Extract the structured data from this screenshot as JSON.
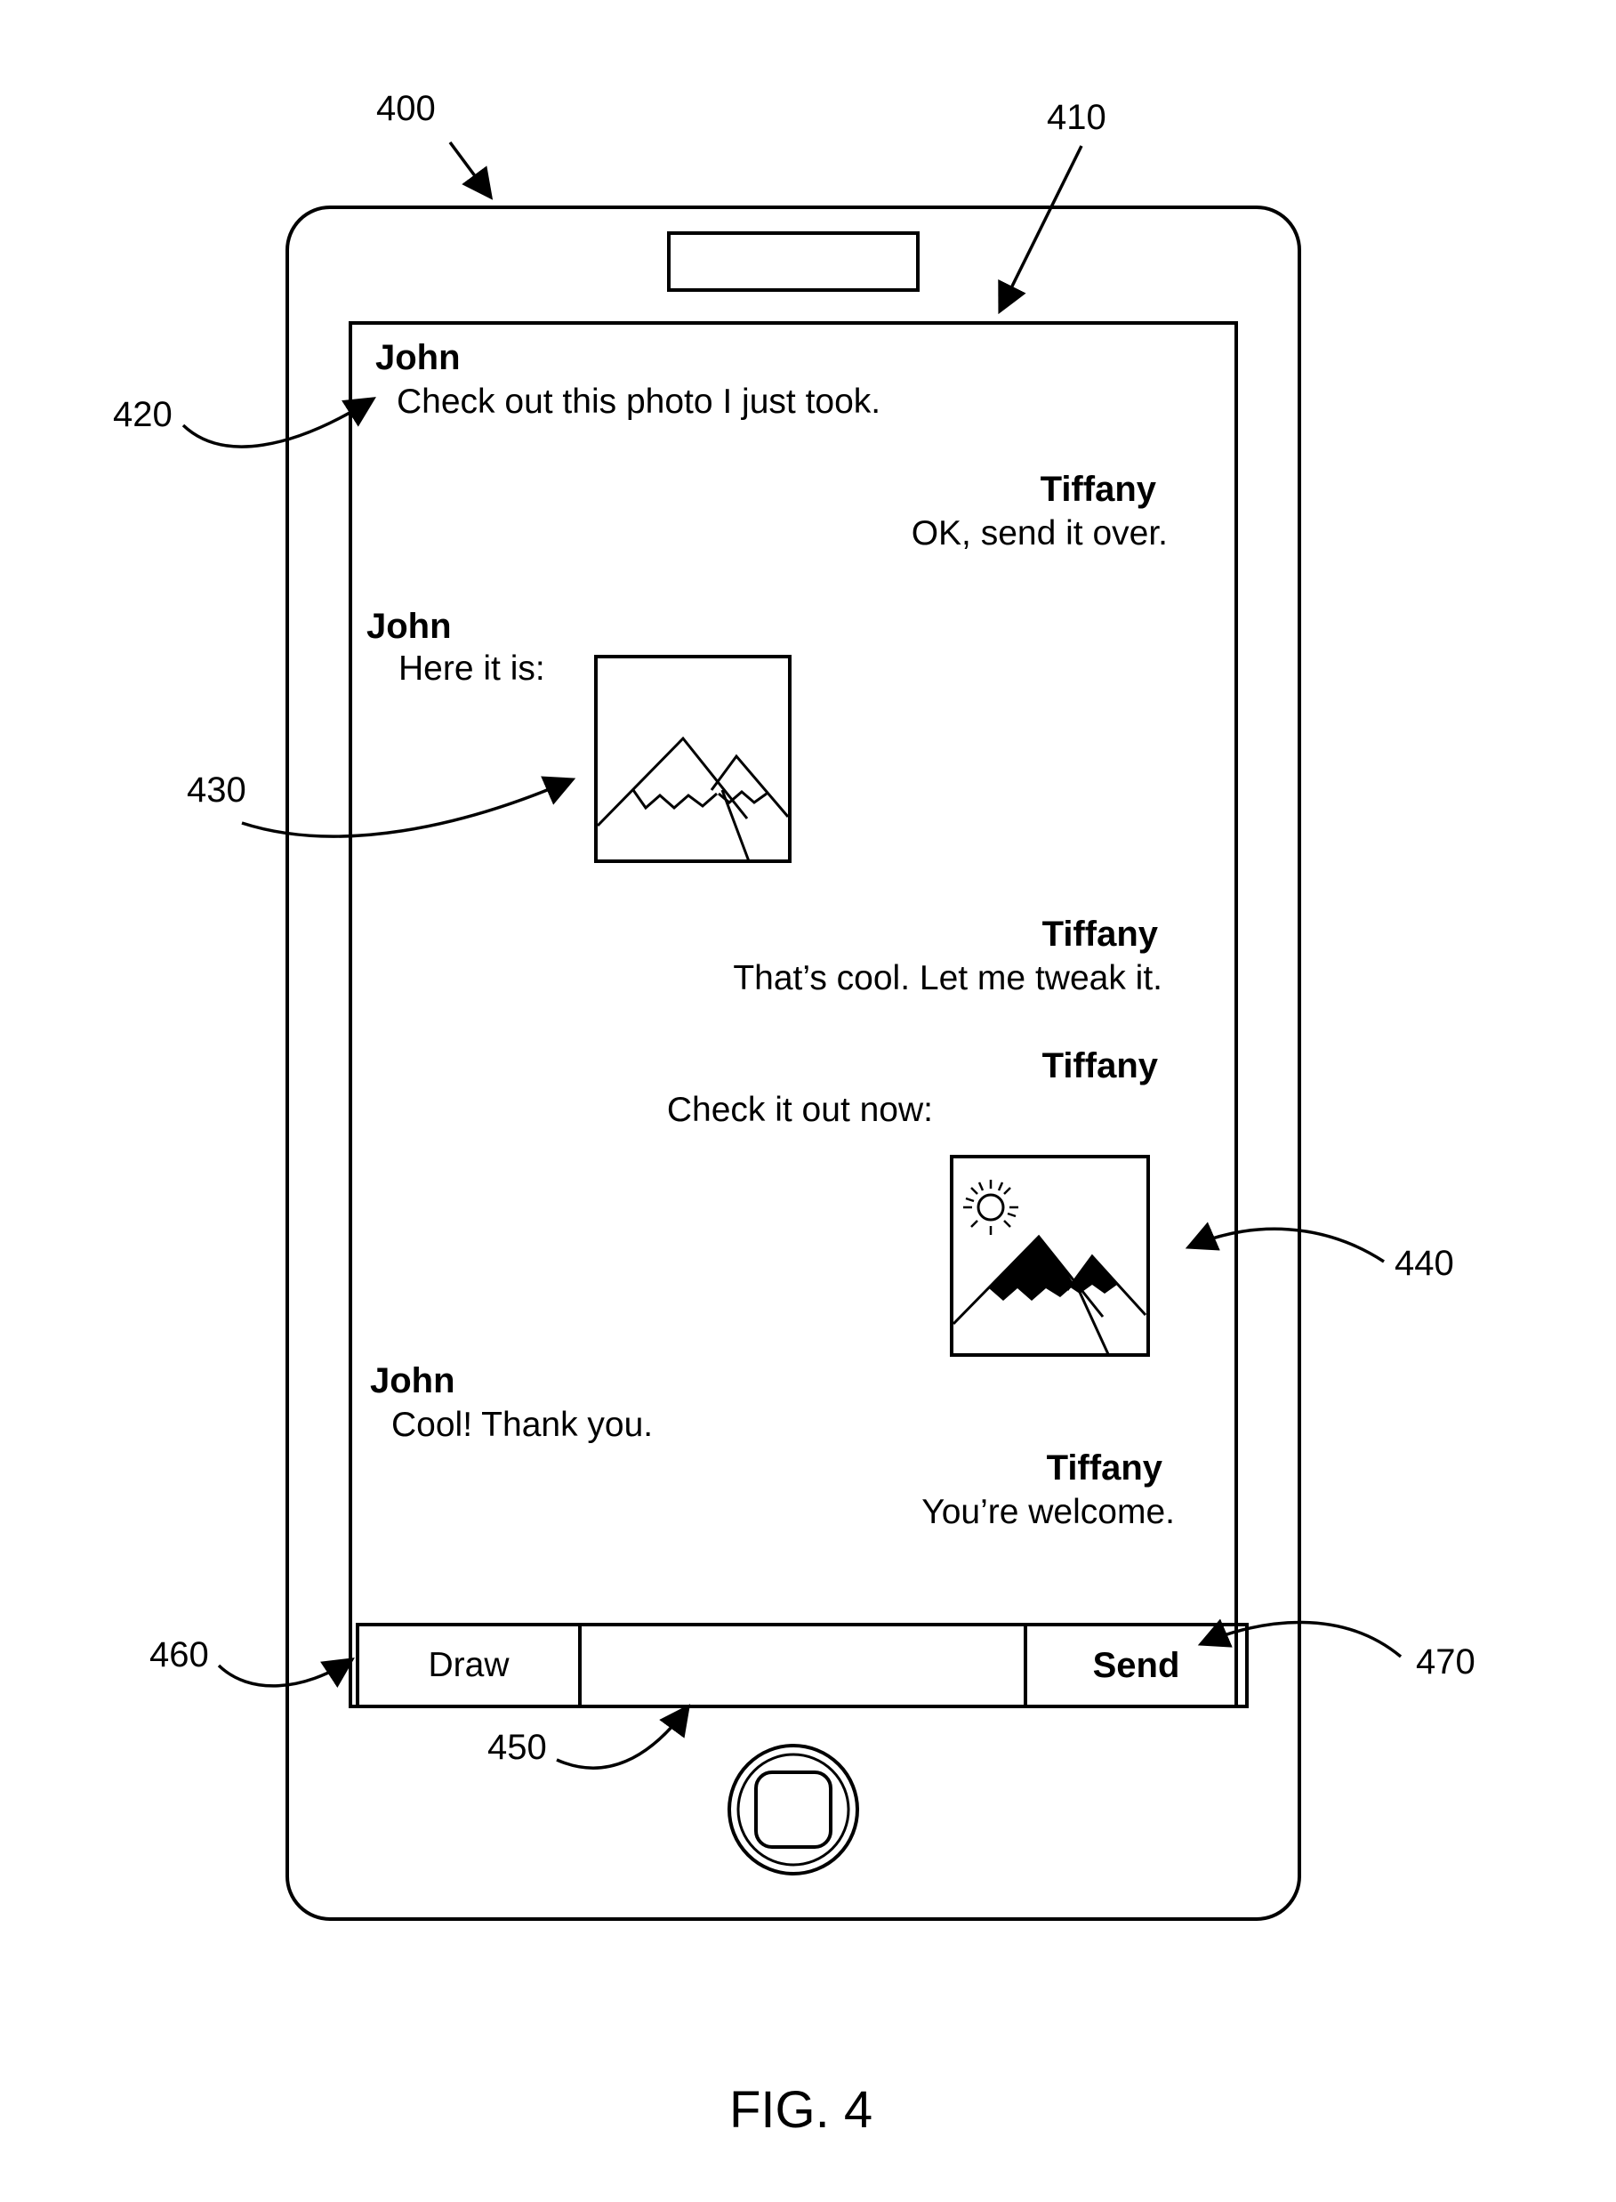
{
  "figure": {
    "caption": "FIG. 4"
  },
  "refs": {
    "device": "400",
    "screen": "410",
    "message": "420",
    "received_image": "430",
    "edited_image": "440",
    "text_input": "450",
    "draw_button": "460",
    "send_button": "470"
  },
  "messages": [
    {
      "sender": "John",
      "text": "Check out this photo I just took."
    },
    {
      "sender": "Tiffany",
      "text": "OK, send it over."
    },
    {
      "sender": "John",
      "text": "Here it is:"
    },
    {
      "sender": "Tiffany",
      "text": "That’s cool. Let me tweak it."
    },
    {
      "sender": "Tiffany",
      "text": "Check it out now:"
    },
    {
      "sender": "John",
      "text": "Cool! Thank you."
    },
    {
      "sender": "Tiffany",
      "text": "You’re welcome."
    }
  ],
  "images": [
    {
      "icon": "mountain-photo-icon"
    },
    {
      "icon": "mountain-photo-with-sun-icon"
    }
  ],
  "input_bar": {
    "draw_label": "Draw",
    "input_value": "",
    "send_label": "Send"
  },
  "device": {
    "home_button_icon": "home-button-icon",
    "speaker_icon": "speaker-slot-icon"
  }
}
